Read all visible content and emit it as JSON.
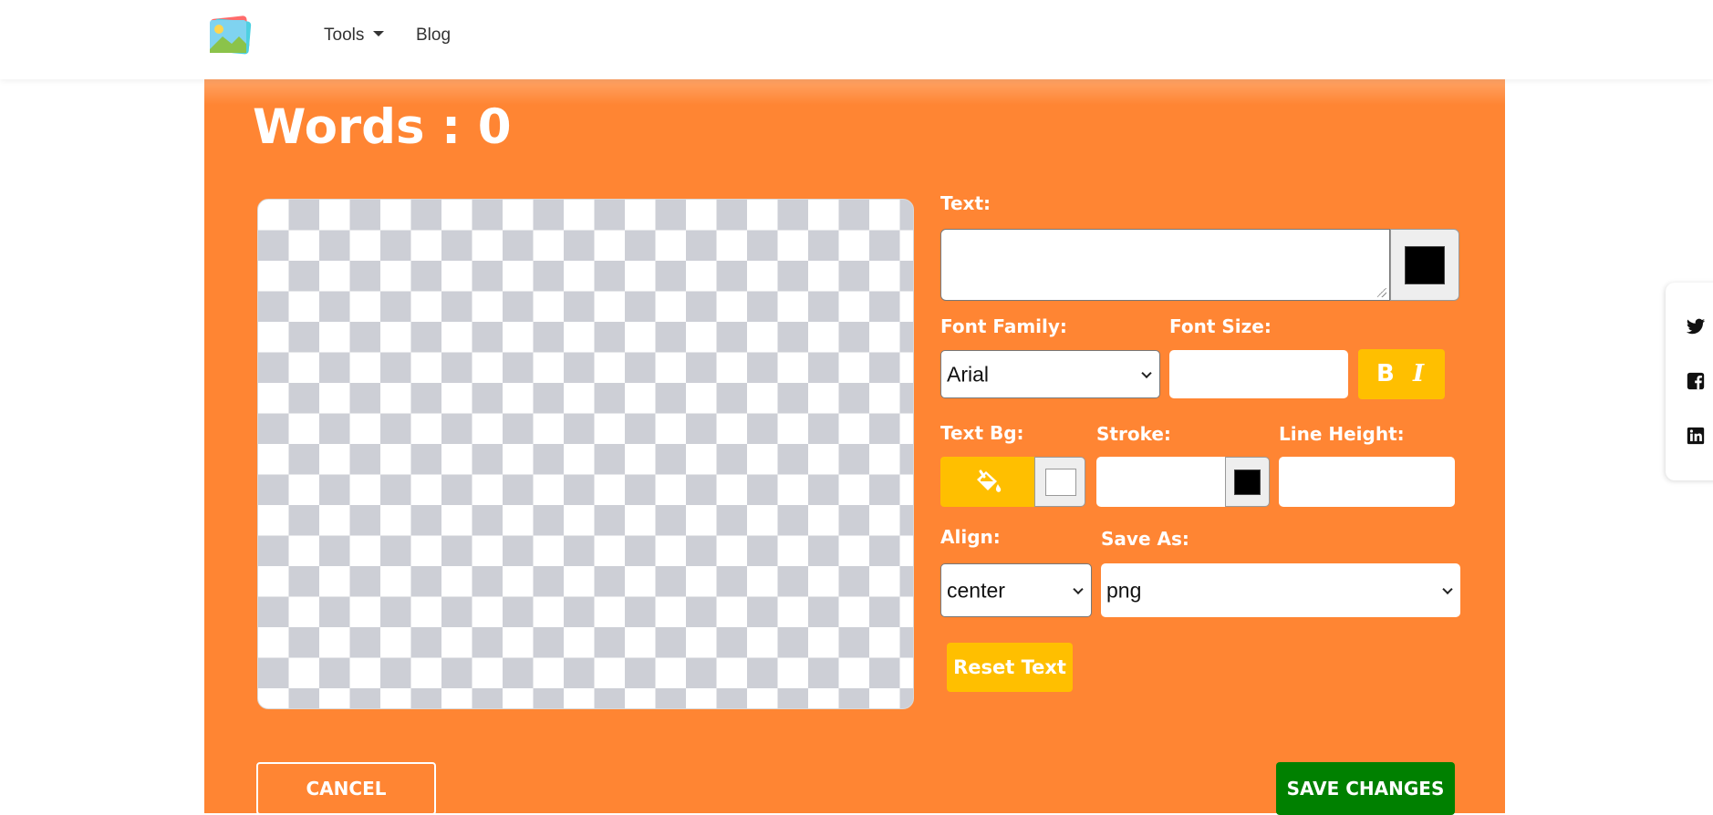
{
  "nav": {
    "logo": "image-logo-icon",
    "tools_label": "Tools",
    "blog_label": "Blog"
  },
  "editor": {
    "words_title": "Words : 0",
    "labels": {
      "text": "Text:",
      "font_family": "Font Family:",
      "font_size": "Font Size:",
      "text_bg": "Text Bg:",
      "stroke": "Stroke:",
      "line_height": "Line Height:",
      "align": "Align:",
      "save_as": "Save As:"
    },
    "text_value": "",
    "text_color": "#000000",
    "font_family_value": "Arial",
    "font_size_value": "",
    "bold_label": "B",
    "italic_label": "I",
    "text_bg_color": "#ffffff",
    "stroke_value": "",
    "stroke_color": "#000000",
    "line_height_value": "",
    "align_value": "center",
    "save_as_value": "png",
    "reset_label": "Reset Text"
  },
  "actions": {
    "cancel_label": "CANCEL",
    "save_label": "SAVE CHANGES"
  },
  "share": {
    "icons": [
      "twitter-icon",
      "facebook-icon",
      "linkedin-icon"
    ]
  },
  "colors": {
    "panel": "#ff8533",
    "accent_yellow": "#ffbf00",
    "save_green": "#008000"
  }
}
